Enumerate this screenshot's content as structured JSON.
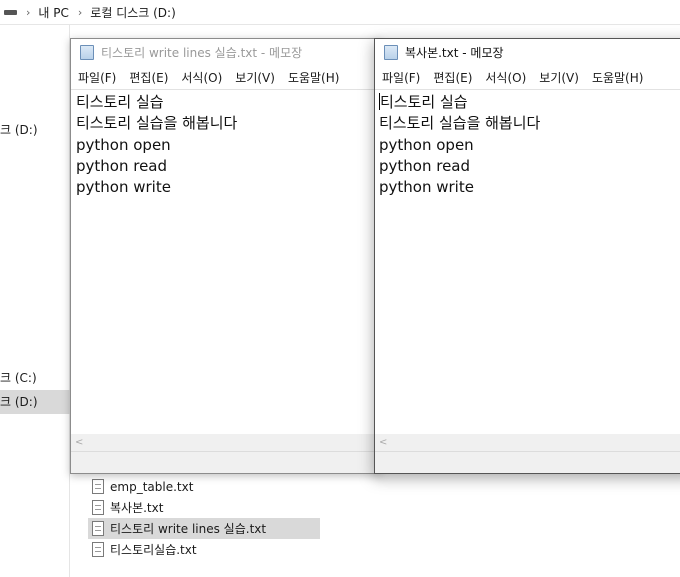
{
  "explorer": {
    "breadcrumb": [
      "내 PC",
      "로컬 디스크 (D:)"
    ],
    "nav_items": [
      {
        "label": "크 (D:)",
        "selected": false
      },
      {
        "label": "크 (C:)",
        "selected": false
      },
      {
        "label": "크 (D:)",
        "selected": true
      }
    ],
    "files": [
      {
        "name": "emp_table.txt",
        "selected": false
      },
      {
        "name": "복사본.txt",
        "selected": false
      },
      {
        "name": "티스토리 write lines 실습.txt",
        "selected": true
      },
      {
        "name": "티스토리실습.txt",
        "selected": false
      }
    ]
  },
  "notepad_left": {
    "title": "티스토리 write lines 실습.txt - 메모장",
    "menu": [
      "파일(F)",
      "편집(E)",
      "서식(O)",
      "보기(V)",
      "도움말(H)"
    ],
    "lines": [
      "티스토리 실습",
      "티스토리 실습을 해봅니다",
      "python open",
      "python read",
      "python write"
    ]
  },
  "notepad_right": {
    "title": "복사본.txt - 메모장",
    "menu": [
      "파일(F)",
      "편집(E)",
      "서식(O)",
      "보기(V)",
      "도움말(H)"
    ],
    "lines": [
      "티스토리 실습",
      "티스토리 실습을 해봅니다",
      "python open",
      "python read",
      "python write"
    ]
  }
}
